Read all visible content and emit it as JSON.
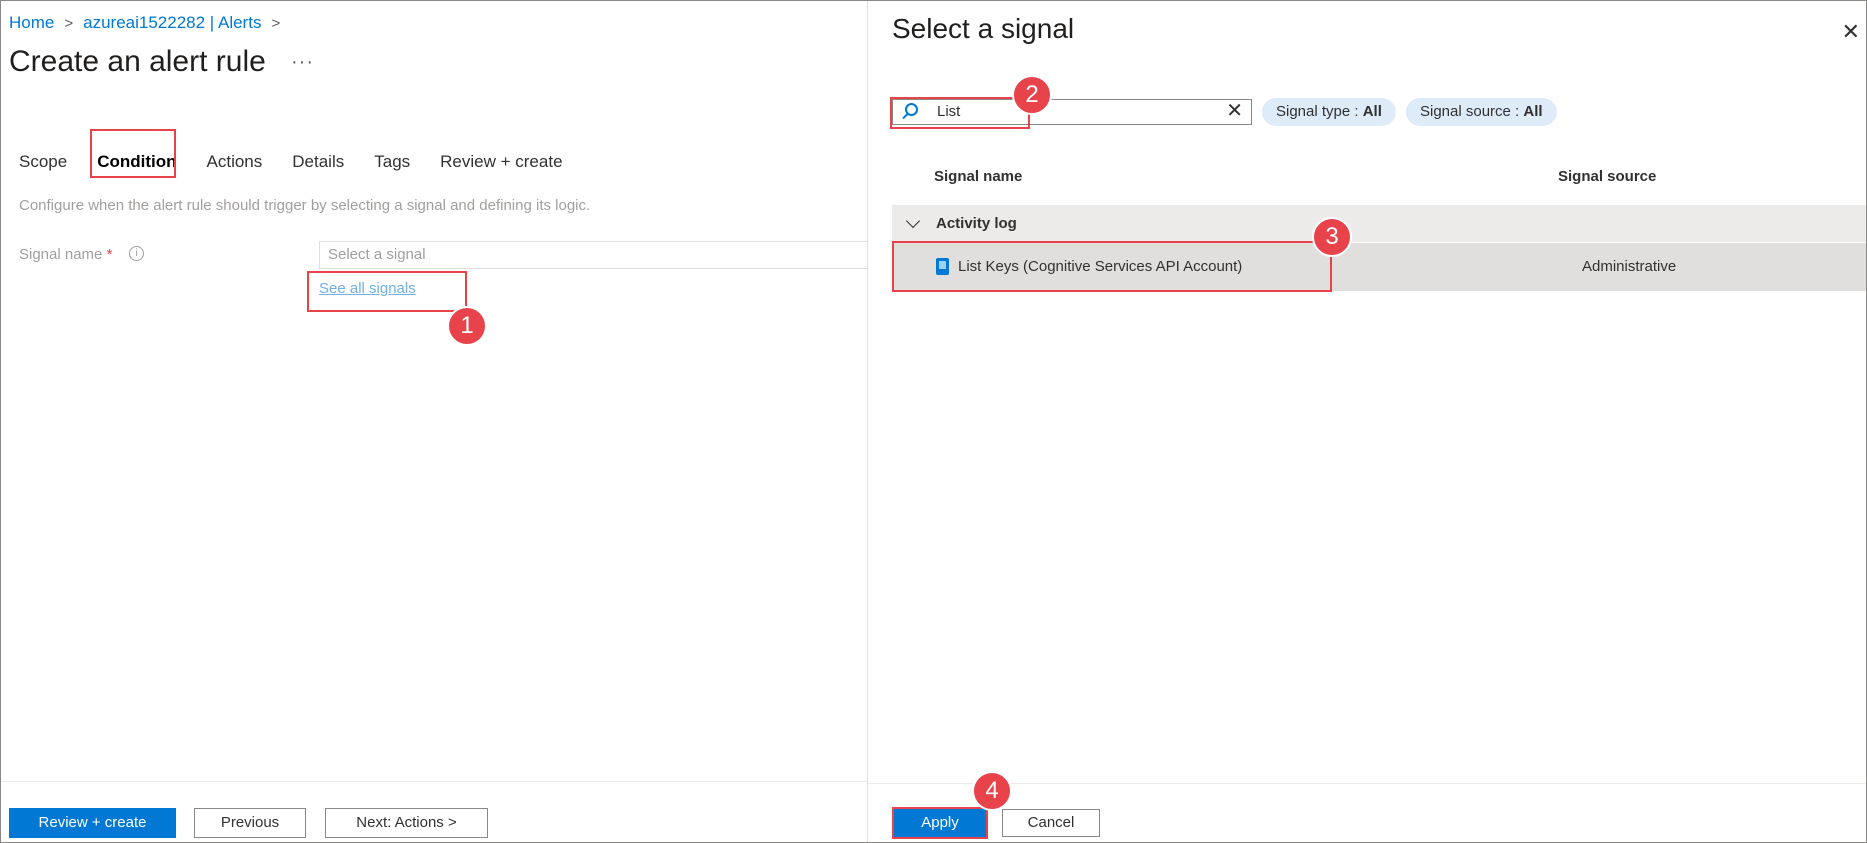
{
  "breadcrumb": {
    "home": "Home",
    "resource": "azureai1522282 | Alerts"
  },
  "page": {
    "title": "Create an alert rule",
    "more": "···"
  },
  "tabs": [
    {
      "label": "Scope"
    },
    {
      "label": "Condition"
    },
    {
      "label": "Actions"
    },
    {
      "label": "Details"
    },
    {
      "label": "Tags"
    },
    {
      "label": "Review + create"
    }
  ],
  "condition": {
    "description": "Configure when the alert rule should trigger by selecting a signal and defining its logic.",
    "signal_label": "Signal name",
    "required_mark": "*",
    "info": "i",
    "signal_placeholder": "Select a signal",
    "see_all_link": "See all signals"
  },
  "left_footer": {
    "review_create": "Review + create",
    "previous": "Previous",
    "next": "Next: Actions >"
  },
  "panel": {
    "title": "Select a signal",
    "close": "✕",
    "search_value": "List",
    "search_clear": "✕",
    "filters": {
      "signal_type_label": "Signal type : ",
      "signal_type_value": "All",
      "signal_source_label": "Signal source : ",
      "signal_source_value": "All"
    },
    "columns": {
      "name": "Signal name",
      "source": "Signal source"
    },
    "group": "Activity log",
    "rows": [
      {
        "name": "List Keys (Cognitive Services API Account)",
        "source": "Administrative"
      }
    ],
    "apply": "Apply",
    "cancel": "Cancel"
  },
  "annotations": [
    "1",
    "2",
    "3",
    "4"
  ],
  "colors": {
    "accent": "#0078d4",
    "callout": "#e8434b",
    "pill_bg": "#deecf9"
  },
  "icons": [
    "chevron-right-icon",
    "more-icon",
    "info-icon",
    "search-icon",
    "clear-icon",
    "close-icon",
    "chevron-down-icon",
    "signal-icon"
  ]
}
